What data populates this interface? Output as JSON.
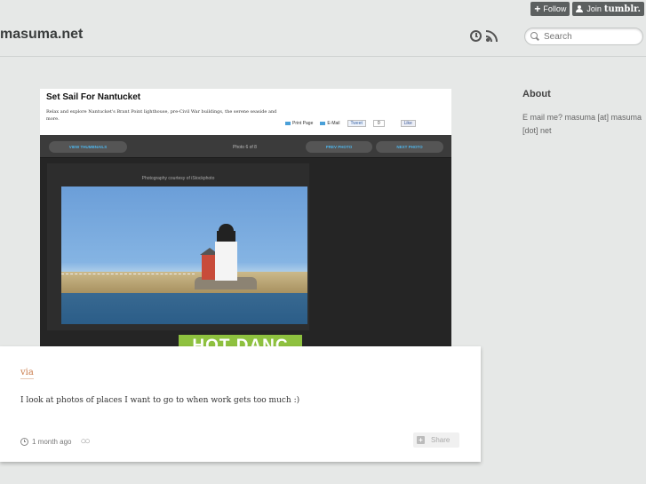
{
  "tumblr": {
    "follow_label": "Follow",
    "join_label": "Join",
    "brand": "tumblr."
  },
  "header": {
    "site_title": "masuma.net",
    "search_placeholder": "Search"
  },
  "sidebar": {
    "about_title": "About",
    "about_text": "E mail me? masuma [at] masuma [dot] net"
  },
  "embedded": {
    "title": "Set Sail For Nantucket",
    "description": "Relax and explore Nantucket's Brant Point lighthouse, pre-Civil War buildings, the serene seaside and more.",
    "print_label": "Print Page",
    "email_label": "E-Mail",
    "tweet_label": "Tweet",
    "tweet_count": "0",
    "like_label": "Like",
    "thumbnails_label": "VIEW THUMBNAILS",
    "counter": "Photo 6 of 8",
    "prev_label": "PREV PHOTO",
    "next_label": "NEXT PHOTO",
    "credit": "Photography courtesy of iStockphoto",
    "ad_text": "HOT DANC"
  },
  "post": {
    "via_label": "via",
    "caption": "I look at photos of places I want to go to when work gets too much :)",
    "timestamp": "1 month ago",
    "share_label": "Share"
  }
}
